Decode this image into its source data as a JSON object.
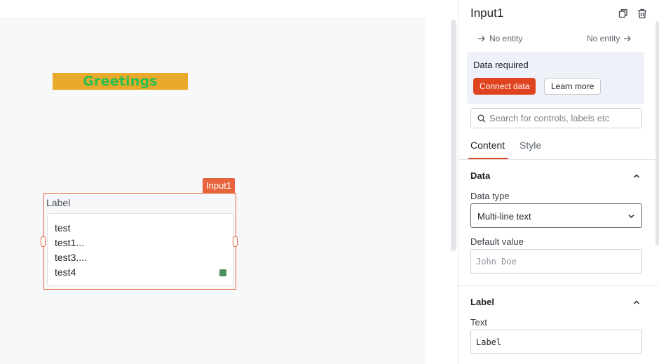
{
  "canvas": {
    "greeting_text": "Greetings",
    "widget": {
      "tag": "Input1",
      "label": "Label",
      "lines": [
        "test",
        "test1...",
        "test3....",
        "test4"
      ]
    }
  },
  "panel": {
    "title": "Input1",
    "entity_left": "No entity",
    "entity_right": "No entity",
    "alert": {
      "title": "Data required",
      "connect_label": "Connect data",
      "learn_label": "Learn more"
    },
    "search": {
      "placeholder": "Search for controls, labels etc"
    },
    "tabs": [
      {
        "label": "Content",
        "active": true
      },
      {
        "label": "Style",
        "active": false
      }
    ],
    "data_section": {
      "title": "Data",
      "data_type_label": "Data type",
      "data_type_value": "Multi-line text",
      "default_value_label": "Default value",
      "default_value_placeholder": "John Doe"
    },
    "label_section": {
      "title": "Label",
      "text_label": "Text",
      "text_value": "Label"
    }
  },
  "colors": {
    "accent": "#e0431f",
    "widget_outline": "#e8643c",
    "greeting_bg": "#e9aa2b",
    "greeting_text": "#2bbf4e",
    "canvas_bg": "#f7f8fa"
  },
  "icons": [
    "copy-icon",
    "trash-icon",
    "arrow-right-icon",
    "search-icon",
    "chevron-up-icon",
    "chevron-down-icon"
  ]
}
